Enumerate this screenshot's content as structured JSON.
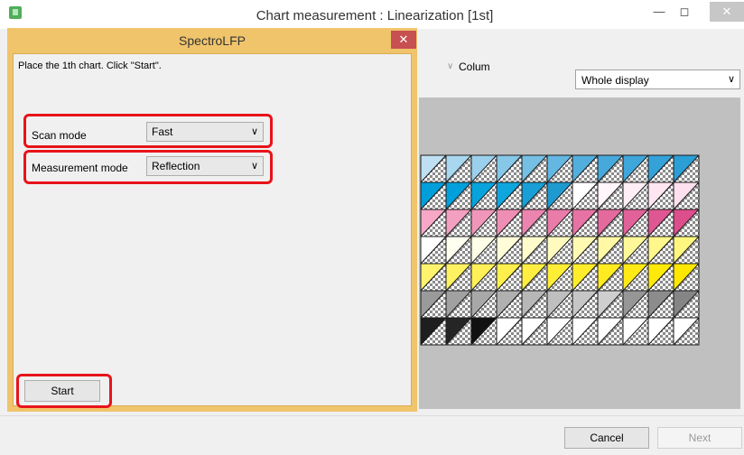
{
  "main_window": {
    "title": "Chart measurement : Linearization [1st]",
    "column_label": "Colum",
    "display_select": "Whole display",
    "buttons": {
      "cancel": "Cancel",
      "next": "Next"
    }
  },
  "dialog": {
    "title": "SpectroLFP",
    "instruction": "Place the 1th chart.  Click \"Start\".",
    "scan_mode": {
      "label": "Scan mode",
      "value": "Fast"
    },
    "measurement_mode": {
      "label": "Measurement mode",
      "value": "Reflection"
    },
    "start_button": "Start"
  },
  "chart_patches": {
    "rows": [
      [
        "#bfe0f2",
        "#a8d7ef",
        "#9bd0ec",
        "#87c7e8",
        "#76bfe4",
        "#64b7e1",
        "#52afdd",
        "#47a9db",
        "#3ea6da",
        "#34a2d8",
        "#2b9ed6"
      ],
      [
        "#009fdb",
        "#00a0dc",
        "#06a3dc",
        "#0fa6dd",
        "#179fd6",
        "#1f9ad0",
        "#ffffff",
        "#fff5fa",
        "#ffeef6",
        "#ffe6f1",
        "#ffe0ee"
      ],
      [
        "#f6a8c6",
        "#f39fc0",
        "#f096ba",
        "#ee8eb5",
        "#eb85af",
        "#e97ca9",
        "#e673a3",
        "#e46a9e",
        "#e26198",
        "#df5792",
        "#dd4e8c"
      ],
      [
        "#ffffff",
        "#fffff0",
        "#fffee6",
        "#fffdd8",
        "#fffccc",
        "#fffbbf",
        "#fffab2",
        "#fff9a6",
        "#fff899",
        "#fff78c",
        "#fff680"
      ],
      [
        "#fff36e",
        "#fff262",
        "#fff057",
        "#ffef4c",
        "#ffee41",
        "#ffed36",
        "#ffec2b",
        "#ffeb20",
        "#ffea16",
        "#ffe90b",
        "#ffe800"
      ],
      [
        "#9a9a9a",
        "#a1a1a1",
        "#a8a8a8",
        "#b0b0b0",
        "#b7b7b7",
        "#bfbfbf",
        "#c6c6c6",
        "#cecece",
        "#969696",
        "#8c8c8c",
        "#858585"
      ],
      [
        "#1e1e1e",
        "#252525",
        "#111111",
        "#ffffff",
        "#ffffff",
        "#ffffff",
        "#ffffff",
        "#ffffff",
        "#ffffff",
        "#ffffff",
        "#ffffff"
      ]
    ]
  }
}
